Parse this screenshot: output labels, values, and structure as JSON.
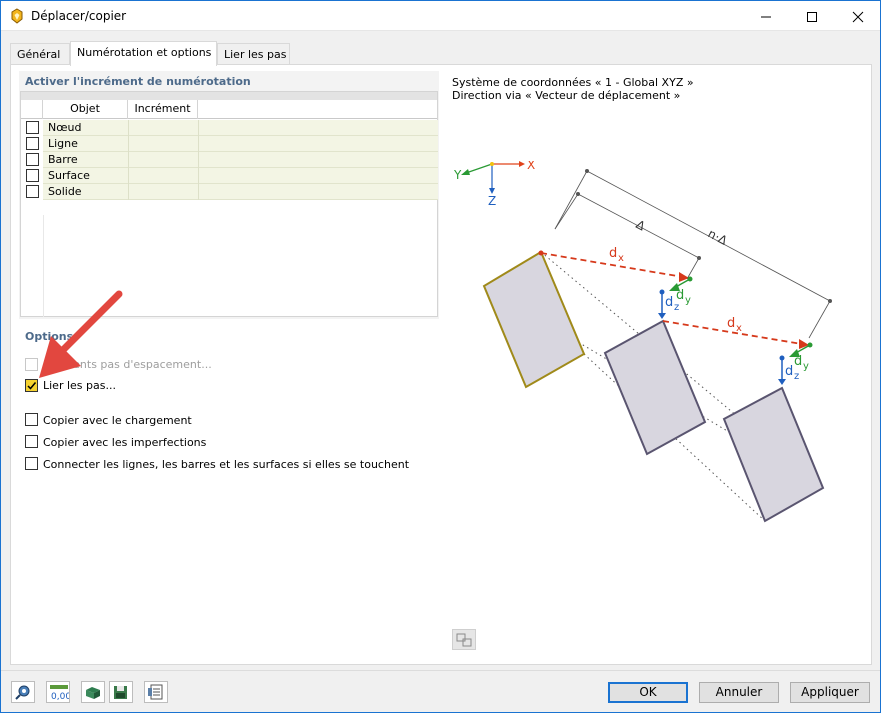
{
  "window": {
    "title": "Déplacer/copier"
  },
  "tabs": [
    {
      "label": "Général",
      "active": false
    },
    {
      "label": "Numérotation et options",
      "active": true
    },
    {
      "label": "Lier les pas",
      "active": false
    }
  ],
  "numbering": {
    "title": "Activer l'incrément de numérotation",
    "columns": [
      "Objet",
      "Incrément"
    ],
    "rows": [
      {
        "name": "Nœud",
        "checked": false
      },
      {
        "name": "Ligne",
        "checked": false
      },
      {
        "name": "Barre",
        "checked": false
      },
      {
        "name": "Surface",
        "checked": false
      },
      {
        "name": "Solide",
        "checked": false
      }
    ]
  },
  "options": {
    "title": "Options",
    "items": [
      {
        "label": "Différents pas d'espacement...",
        "checked": false,
        "disabled": true
      },
      {
        "label": "Lier les pas...",
        "checked": true,
        "disabled": false
      },
      {
        "label": "Copier avec le chargement",
        "checked": false,
        "disabled": false
      },
      {
        "label": "Copier avec les imperfections",
        "checked": false,
        "disabled": false
      },
      {
        "label": "Connecter les lignes, les barres et les surfaces si elles se touchent",
        "checked": false,
        "disabled": false
      }
    ]
  },
  "preview": {
    "coord_system": "Système de coordonnées « 1 - Global XYZ »",
    "direction": "Direction via « Vecteur de déplacement »",
    "axis_labels": {
      "x": "X",
      "y": "Y",
      "z": "Z"
    },
    "dim_labels": {
      "delta": "Δ",
      "n_delta": "n·Δ",
      "dx": "d",
      "dx_sub": "x",
      "dy": "d",
      "dy_sub": "y",
      "dz": "d",
      "dz_sub": "z"
    }
  },
  "buttons": {
    "ok": "OK",
    "cancel": "Annuler",
    "apply": "Appliquer"
  },
  "colors": {
    "accent": "#1a73d1",
    "group_title": "#4d6a8a",
    "checked_fill": "#f5d230",
    "arrow_red": "#e2473f",
    "x_axis": "#e0431b",
    "y_axis": "#2a9a34",
    "z_axis": "#1f5fbf"
  }
}
